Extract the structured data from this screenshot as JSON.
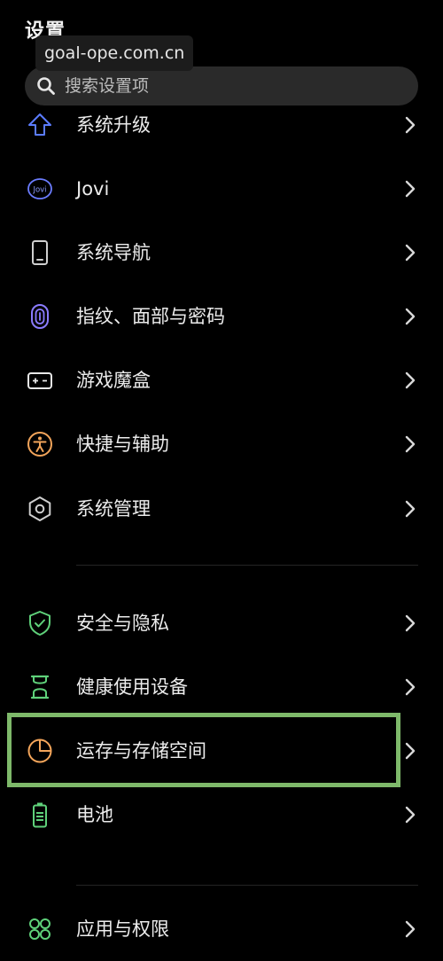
{
  "header": {
    "title": "设置",
    "watermark": "goal-ope.com.cn"
  },
  "search": {
    "placeholder": "搜索设置项",
    "icon": "search-icon"
  },
  "settings_group_1": [
    {
      "label": "系统升级",
      "icon": "upgrade-arrow-icon",
      "color": "#5b7cff"
    },
    {
      "label": "Jovi",
      "icon": "jovi-icon",
      "color": "#6b7cff"
    },
    {
      "label": "系统导航",
      "icon": "phone-navigation-icon",
      "color": "#cfcfcf"
    },
    {
      "label": "指纹、面部与密码",
      "icon": "fingerprint-icon",
      "color": "#8a7bff"
    },
    {
      "label": "游戏魔盒",
      "icon": "gamepad-icon",
      "color": "#e8e8e8"
    },
    {
      "label": "快捷与辅助",
      "icon": "accessibility-icon",
      "color": "#f2a45a"
    },
    {
      "label": "系统管理",
      "icon": "hexagon-settings-icon",
      "color": "#cfcfcf"
    }
  ],
  "settings_group_2": [
    {
      "label": "安全与隐私",
      "icon": "shield-check-icon",
      "color": "#5fd17a"
    },
    {
      "label": "健康使用设备",
      "icon": "hourglass-icon",
      "color": "#5fd17a"
    },
    {
      "label": "运存与存储空间",
      "icon": "pie-chart-icon",
      "color": "#f5a65b"
    },
    {
      "label": "电池",
      "icon": "battery-icon",
      "color": "#5fd17a"
    }
  ],
  "settings_group_3": [
    {
      "label": "应用与权限",
      "icon": "apps-grid-icon",
      "color": "#5fd17a"
    }
  ],
  "highlight": {
    "color": "#7eb96a",
    "target": "运存与存储空间"
  }
}
